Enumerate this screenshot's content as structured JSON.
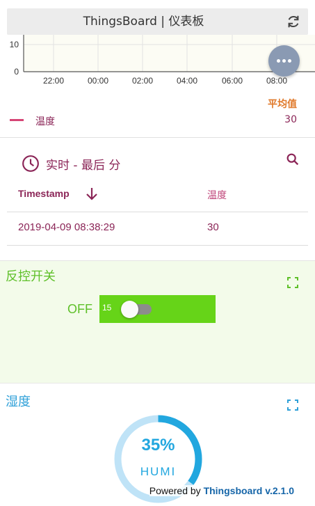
{
  "header": {
    "title": "ThingsBoard | 仪表板"
  },
  "chart_data": {
    "type": "line",
    "x_ticks": [
      "22:00",
      "00:00",
      "02:00",
      "04:00",
      "06:00",
      "08:00"
    ],
    "y_ticks": [
      "0",
      "10"
    ],
    "series": [
      {
        "name": "温度",
        "values": []
      }
    ],
    "grid": true
  },
  "legend": {
    "avg_label": "平均值",
    "series_name": "温度",
    "series_color": "#d64575",
    "avg_value": "30"
  },
  "timeseries_table": {
    "title": "实时 - 最后 分",
    "columns": [
      "Timestamp",
      "温度"
    ],
    "rows": [
      {
        "timestamp": "2019-04-09 08:38:29",
        "temp": "30"
      }
    ]
  },
  "switch_card": {
    "title": "反控开关",
    "state_label": "OFF",
    "value": "15",
    "accent": "#66d418"
  },
  "gauge_card": {
    "title": "湿度",
    "value_text": "35%",
    "unit": "HUMI",
    "level": 0.35,
    "accent": "#22a7df"
  },
  "footer": {
    "powered_prefix": "Powered by ",
    "brand": "Thingsboard v.2.1.0"
  }
}
